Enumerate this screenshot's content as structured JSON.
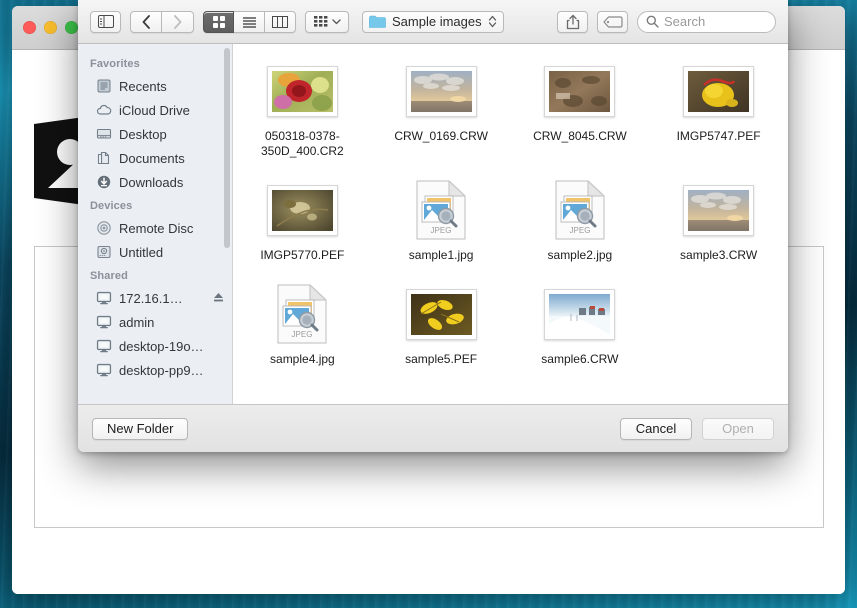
{
  "window": {
    "traffic_lights": [
      "close",
      "minimize",
      "zoom"
    ],
    "placeholder_icon": "image-placeholder-icon"
  },
  "dialog": {
    "toolbar": {
      "sidebar_toggle_icon": "sidebar-toggle-icon",
      "back_icon": "chevron-left-icon",
      "forward_icon": "chevron-right-icon",
      "view_icon_label": "icon-view",
      "view_list_label": "list-view",
      "view_column_label": "column-view",
      "arrange_icon": "arrange-grid-icon",
      "arrange_chevron": "chevron-down-icon",
      "path_label": "Sample images",
      "path_folder_icon": "folder-icon",
      "path_stepper_icon": "updown-stepper-icon",
      "share_icon": "share-icon",
      "tag_icon": "tag-icon",
      "search_icon": "search-icon",
      "search_placeholder": "Search",
      "search_value": ""
    },
    "sidebar": {
      "groups": [
        {
          "title": "Favorites",
          "items": [
            {
              "label": "Recents",
              "icon": "recents-icon"
            },
            {
              "label": "iCloud Drive",
              "icon": "icloud-icon"
            },
            {
              "label": "Desktop",
              "icon": "desktop-icon"
            },
            {
              "label": "Documents",
              "icon": "documents-icon"
            },
            {
              "label": "Downloads",
              "icon": "downloads-icon"
            }
          ]
        },
        {
          "title": "Devices",
          "items": [
            {
              "label": "Remote Disc",
              "icon": "disc-icon"
            },
            {
              "label": "Untitled",
              "icon": "harddisk-icon"
            }
          ]
        },
        {
          "title": "Shared",
          "items": [
            {
              "label": "172.16.1…",
              "icon": "computer-icon",
              "eject": true
            },
            {
              "label": "admin",
              "icon": "computer-icon"
            },
            {
              "label": "desktop-19o…",
              "icon": "computer-icon"
            },
            {
              "label": "desktop-pp9…",
              "icon": "computer-icon"
            }
          ]
        }
      ]
    },
    "files": [
      {
        "name": "050318-0378-350D_400.CR2",
        "kind": "photo",
        "thumb": "roses"
      },
      {
        "name": "CRW_0169.CRW",
        "kind": "photo",
        "thumb": "sunset-clouds"
      },
      {
        "name": "CRW_8045.CRW",
        "kind": "photo",
        "thumb": "brown-ground"
      },
      {
        "name": "IMGP5747.PEF",
        "kind": "photo",
        "thumb": "yellow-flower"
      },
      {
        "name": "IMGP5770.PEF",
        "kind": "photo",
        "thumb": "dry-plant"
      },
      {
        "name": "sample1.jpg",
        "kind": "jpeg-doc",
        "badge": "JPEG"
      },
      {
        "name": "sample2.jpg",
        "kind": "jpeg-doc",
        "badge": "JPEG"
      },
      {
        "name": "sample3.CRW",
        "kind": "photo",
        "thumb": "sunset-clouds"
      },
      {
        "name": "sample4.jpg",
        "kind": "jpeg-doc",
        "badge": "JPEG"
      },
      {
        "name": "sample5.PEF",
        "kind": "photo",
        "thumb": "yellow-leaves"
      },
      {
        "name": "sample6.CRW",
        "kind": "photo",
        "thumb": "snow-scene"
      }
    ],
    "buttons": {
      "new_folder": "New Folder",
      "cancel": "Cancel",
      "open": "Open",
      "open_disabled": true
    }
  },
  "colors": {
    "sidebar_bg": "#ebeff3",
    "toolbar_bg": "#eeeeee",
    "selected_view": "#636363",
    "folder_blue": "#6fc4e8",
    "desktop": "#0d5f7a"
  }
}
